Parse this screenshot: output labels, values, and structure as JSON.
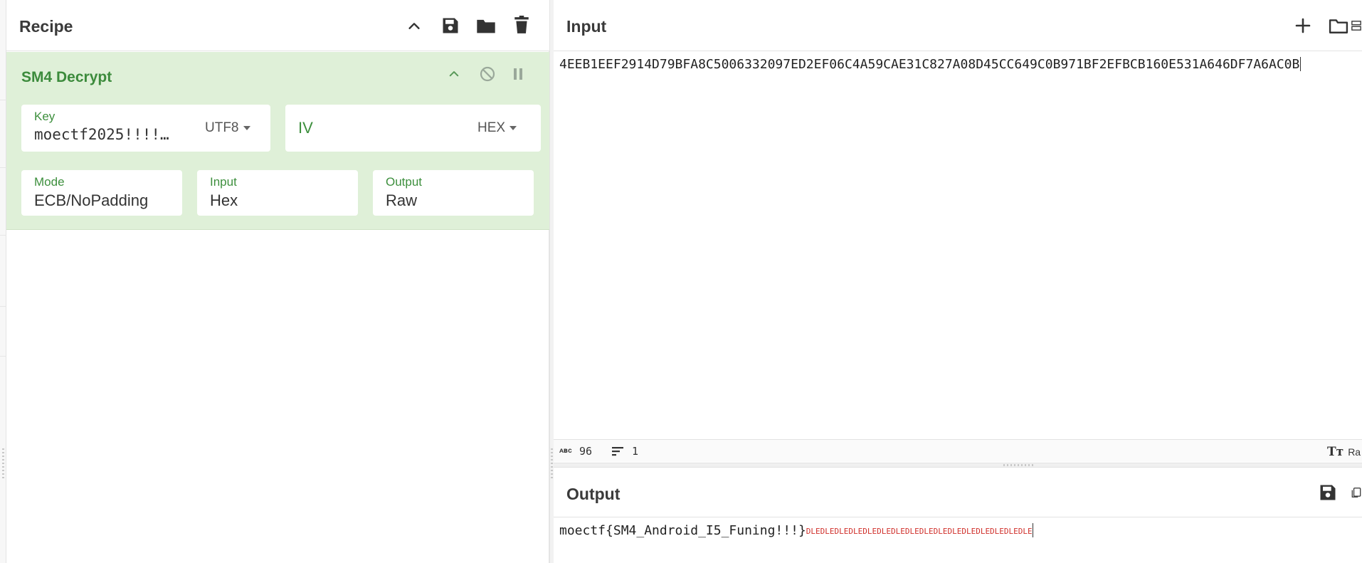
{
  "recipe": {
    "title": "Recipe",
    "icons": [
      "chevron-up-icon",
      "save-icon",
      "folder-icon",
      "trash-icon"
    ]
  },
  "operation": {
    "name": "SM4 Decrypt",
    "key": {
      "label": "Key",
      "value": "moectf2025!!!!…",
      "encoding": "UTF8"
    },
    "iv": {
      "label": "IV",
      "value": "",
      "encoding": "HEX"
    },
    "mode": {
      "label": "Mode",
      "value": "ECB/NoPadding"
    },
    "input": {
      "label": "Input",
      "value": "Hex"
    },
    "output": {
      "label": "Output",
      "value": "Raw"
    }
  },
  "input_pane": {
    "title": "Input",
    "text": "4EEB1EEF2914D79BFA8C5006332097ED2EF06C4A59CAE31C827A08D45CC649C0B971BF2EFBCB160E531A646DF7A6AC0B",
    "stats": {
      "length": "96",
      "lines": "1",
      "format_label": "Ra"
    }
  },
  "output_pane": {
    "title": "Output",
    "text": "moectf{SM4_Android_I5_Funing!!!}",
    "trailing_control_chars": "DLEDLEDLEDLEDLEDLEDLEDLEDLEDLEDLEDLEDLEDLEDLEDLE"
  },
  "colors": {
    "op_bg": "#dff0d8",
    "op_title": "#3c8b3c",
    "field_label": "#3d8f3d",
    "control_char": "#d0302b"
  }
}
